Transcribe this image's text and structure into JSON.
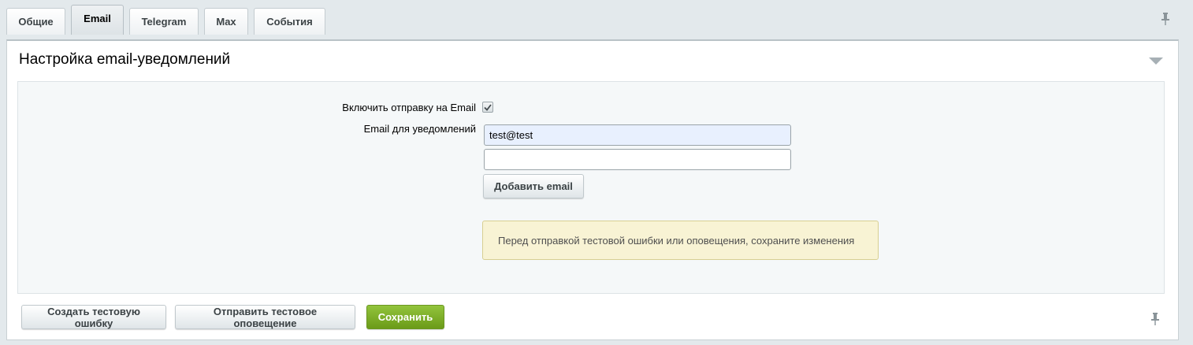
{
  "tabs": [
    {
      "label": "Общие",
      "active": false
    },
    {
      "label": "Email",
      "active": true
    },
    {
      "label": "Telegram",
      "active": false
    },
    {
      "label": "Max",
      "active": false
    },
    {
      "label": "События",
      "active": false
    }
  ],
  "section": {
    "title": "Настройка email-уведомлений"
  },
  "form": {
    "enable_label": "Включить отправку на Email",
    "enable_checked": true,
    "emails_label": "Email для уведомлений",
    "email_1_value": "test@test",
    "email_2_value": "",
    "add_email_label": "Добавить email",
    "notice_text": "Перед отправкой тестовой ошибки или оповещения, сохраните изменения"
  },
  "footer": {
    "create_test_error_label": "Создать тестовую ошибку",
    "send_test_notification_label": "Отправить тестовое оповещение",
    "save_label": "Сохранить"
  },
  "icons": {
    "pin": "pin-icon",
    "collapse": "triangle-down-icon",
    "check": "checkmark-icon"
  },
  "colors": {
    "save_button": "#7aab24",
    "notice_bg": "#f8f3d4"
  }
}
